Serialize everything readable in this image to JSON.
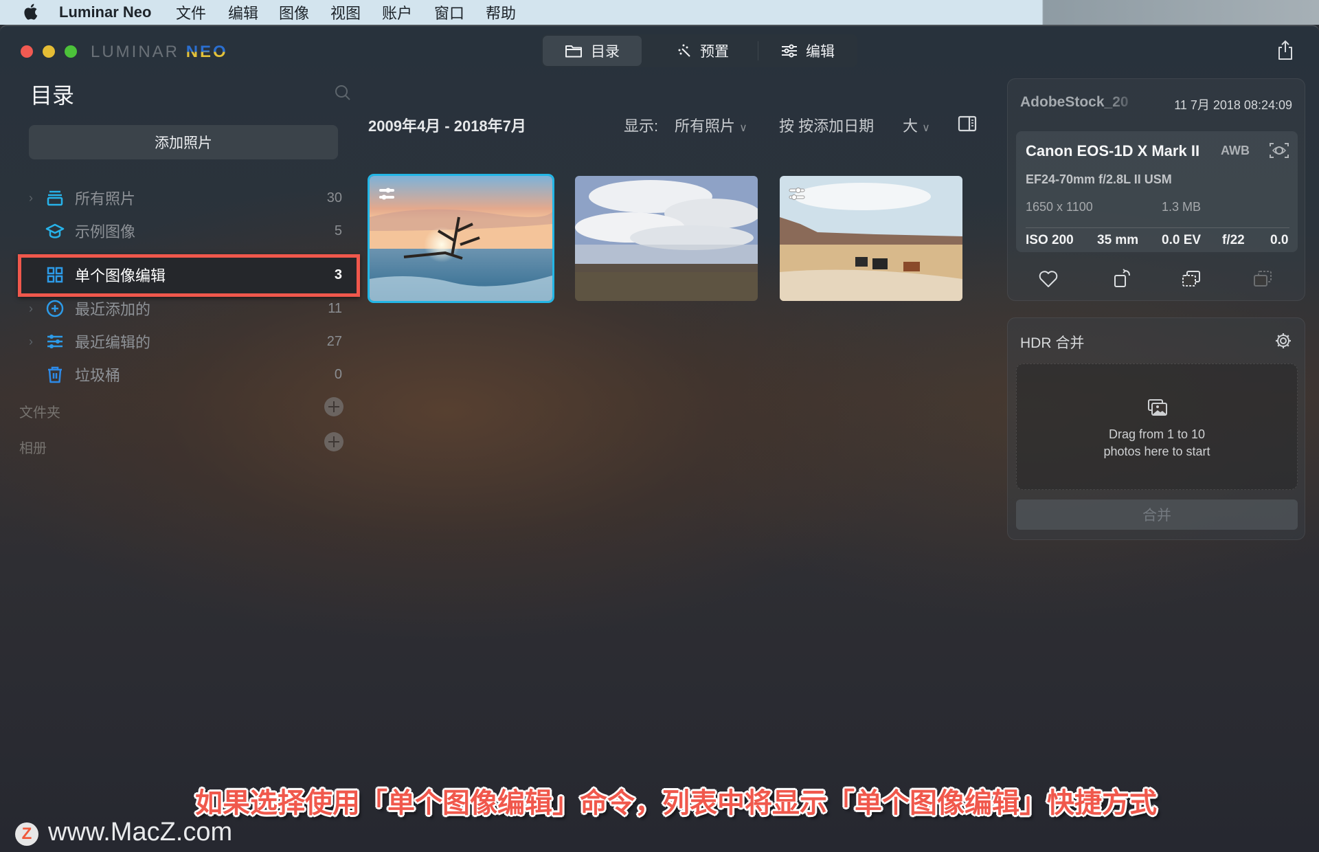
{
  "menubar": {
    "app_name": "Luminar Neo",
    "items": [
      "文件",
      "编辑",
      "图像",
      "视图",
      "账户",
      "窗口",
      "帮助"
    ]
  },
  "window": {
    "logo_part1": "LUMINAR",
    "logo_part2": "NEO",
    "modes": [
      {
        "label": "目录",
        "icon": "folder-icon",
        "active": true
      },
      {
        "label": "预置",
        "icon": "magic-wand-icon",
        "active": false
      },
      {
        "label": "编辑",
        "icon": "sliders-icon",
        "active": false
      }
    ]
  },
  "sidebar": {
    "title": "目录",
    "add_photos_label": "添加照片",
    "items": [
      {
        "label": "所有照片",
        "count": "30",
        "icon": "photos-stack-icon",
        "expandable": true
      },
      {
        "label": "示例图像",
        "count": "5",
        "icon": "graduation-cap-icon",
        "expandable": false
      },
      {
        "label": "单个图像编辑",
        "count": "3",
        "icon": "grid-icon",
        "expandable": false,
        "active": true
      },
      {
        "label": "最近添加的",
        "count": "11",
        "icon": "plus-circle-icon",
        "expandable": true
      },
      {
        "label": "最近编辑的",
        "count": "27",
        "icon": "sliders-icon",
        "expandable": true
      },
      {
        "label": "垃圾桶",
        "count": "0",
        "icon": "trash-icon",
        "expandable": false
      }
    ],
    "sections": [
      {
        "label": "文件夹"
      },
      {
        "label": "相册"
      }
    ]
  },
  "gallery": {
    "date_range": "2009年4月 - 2018年7月",
    "show_label": "显示:",
    "show_value": "所有照片",
    "sort_label": "按 按添加日期",
    "size_value": "大",
    "photos": [
      {
        "subject": "sunset driftwood sea",
        "selected": true,
        "edited": true
      },
      {
        "subject": "clouds over field",
        "selected": false,
        "edited": false
      },
      {
        "subject": "cows in desert",
        "selected": false,
        "edited": true
      }
    ]
  },
  "info_panel": {
    "file_name": "AdobeStock_20",
    "date": "11 7月 2018 08:24:09",
    "camera": "Canon EOS-1D X Mark II",
    "white_balance": "AWB",
    "lens": "EF24-70mm f/2.8L II USM",
    "dimensions": "1650 x 1100",
    "file_size": "1.3 MB",
    "exif": [
      "ISO 200",
      "35 mm",
      "0.0 EV",
      "f/22",
      "0.0"
    ]
  },
  "hdr_panel": {
    "title": "HDR 合并",
    "drop_line1": "Drag from 1 to 10",
    "drop_line2": "photos here to start",
    "merge_label": "合并"
  },
  "overlay": {
    "caption": "如果选择使用「单个图像编辑」命令，列表中将显示「单个图像编辑」快捷方式",
    "watermark": "www.MacZ.com",
    "watermark_logo": "Z"
  },
  "colors": {
    "accent": "#23b6e6",
    "highlight_red": "#f0584c",
    "icon_blue": "#2f8fe0"
  }
}
